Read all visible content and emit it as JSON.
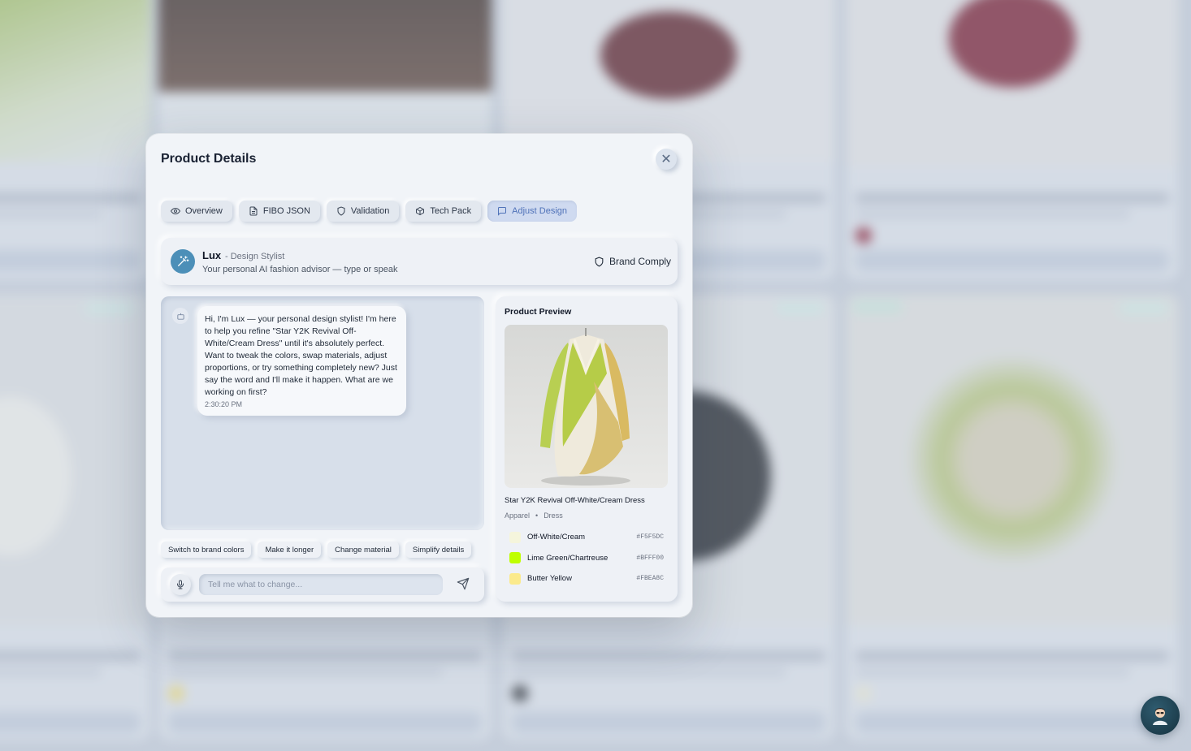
{
  "modal": {
    "title": "Product Details",
    "close_icon": "close-icon"
  },
  "tabs": [
    {
      "label": "Overview",
      "icon": "eye-icon",
      "active": false
    },
    {
      "label": "FIBO JSON",
      "icon": "document-icon",
      "active": false
    },
    {
      "label": "Validation",
      "icon": "shield-icon",
      "active": false
    },
    {
      "label": "Tech Pack",
      "icon": "package-icon",
      "active": false
    },
    {
      "label": "Adjust Design",
      "icon": "chat-icon",
      "active": true
    }
  ],
  "stylist": {
    "name": "Lux",
    "role": "- Design Stylist",
    "description": "Your personal AI fashion advisor — type or speak",
    "icon": "magic-wand-icon",
    "brand_button": "Brand Comply"
  },
  "chat": {
    "messages": [
      {
        "sender": "bot",
        "text": "Hi, I'm Lux — your personal design stylist! I'm here to help you refine \"Star Y2K Revival Off-White/Cream Dress\" until it's absolutely perfect. Want to tweak the colors, swap materials, adjust proportions, or try something completely new? Just say the word and I'll make it happen. What are we working on first?",
        "time": "2:30:20 PM"
      }
    ],
    "suggestions": [
      "Switch to brand colors",
      "Make it longer",
      "Change material",
      "Simplify details"
    ],
    "input_placeholder": "Tell me what to change...",
    "input_value": ""
  },
  "preview": {
    "title": "Product Preview",
    "product_name": "Star Y2K Revival Off-White/Cream Dress",
    "category": "Apparel",
    "subcategory": "Dress",
    "colors": [
      {
        "name": "Off-White/Cream",
        "hex": "#F5F5DC"
      },
      {
        "name": "Lime Green/Chartreuse",
        "hex": "#BFFF00"
      },
      {
        "name": "Butter Yellow",
        "hex": "#FBEA8C"
      }
    ]
  },
  "accent_color": "#4f72b8"
}
